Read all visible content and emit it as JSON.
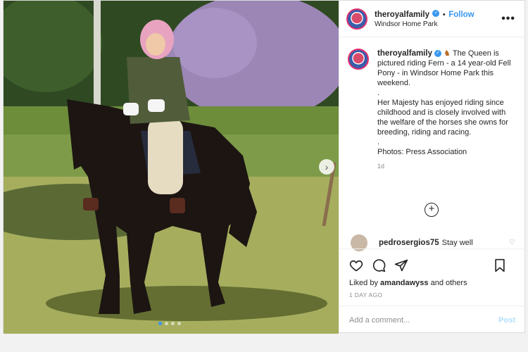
{
  "header": {
    "username": "theroyalfamily",
    "follow_label": "Follow",
    "location": "Windsor Home Park",
    "more_label": "•••"
  },
  "caption": {
    "username": "theroyalfamily",
    "line1": "The Queen is pictured riding Fern - a 14 year-old Fell Pony - in Windsor Home Park this weekend.",
    "sep1": ".",
    "line2": "Her Majesty has enjoyed riding since childhood and is closely involved with the welfare of the horses she owns for breeding, riding and racing.",
    "sep2": ".",
    "line3": "Photos: Press Association",
    "time": "1d"
  },
  "comments": [
    {
      "username": "pedrosergios75",
      "text": "Stay well"
    }
  ],
  "actions": {
    "liked_by_prefix": "Liked by",
    "liked_by_user": "amandawyss",
    "liked_by_suffix": "and others",
    "time_ago": "1 DAY AGO"
  },
  "add_comment": {
    "placeholder": "Add a comment...",
    "post_label": "Post"
  },
  "carousel": {
    "count": 4,
    "active_index": 0
  },
  "colors": {
    "accent": "#3897f0",
    "text": "#262626",
    "muted": "#8e8e8e"
  }
}
